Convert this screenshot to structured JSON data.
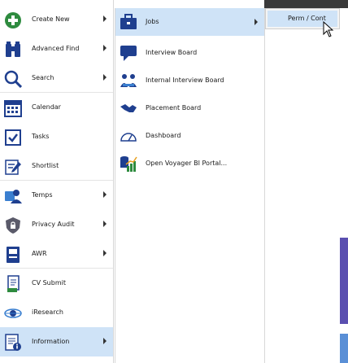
{
  "menu": {
    "items": [
      {
        "label": "Create New",
        "icon": "plus-circle-icon",
        "submenu": true
      },
      {
        "label": "Advanced Find",
        "icon": "binoculars-icon",
        "submenu": true
      },
      {
        "label": "Search",
        "icon": "magnifier-icon",
        "submenu": true
      },
      {
        "label": "Calendar",
        "icon": "calendar-icon",
        "submenu": false
      },
      {
        "label": "Tasks",
        "icon": "tasks-checkbox-icon",
        "submenu": false
      },
      {
        "label": "Shortlist",
        "icon": "shortlist-edit-icon",
        "submenu": false
      },
      {
        "label": "Temps",
        "icon": "temps-people-icon",
        "submenu": true
      },
      {
        "label": "Privacy Audit",
        "icon": "shield-lock-icon",
        "submenu": true
      },
      {
        "label": "AWR",
        "icon": "awr-document-icon",
        "submenu": true
      },
      {
        "label": "CV Submit",
        "icon": "cv-submit-icon",
        "submenu": false
      },
      {
        "label": "iResearch",
        "icon": "iresearch-globe-icon",
        "submenu": false
      },
      {
        "label": "Information",
        "icon": "information-document-icon",
        "submenu": true,
        "selected": true
      }
    ]
  },
  "submenu": {
    "items": [
      {
        "label": "Jobs",
        "icon": "briefcase-icon",
        "submenu": true,
        "selected": true
      },
      {
        "label": "Interview Board",
        "icon": "speech-bubble-icon",
        "submenu": false
      },
      {
        "label": "Internal Interview Board",
        "icon": "interview-people-icon",
        "submenu": false
      },
      {
        "label": "Placement Board",
        "icon": "handshake-icon",
        "submenu": false
      },
      {
        "label": "Dashboard",
        "icon": "speedometer-icon",
        "submenu": false
      },
      {
        "label": "Open Voyager BI Portal...",
        "icon": "bi-chart-icon",
        "submenu": false
      }
    ]
  },
  "submenu2": {
    "items": [
      {
        "label": "Perm / Cont",
        "selected": true
      }
    ]
  },
  "colors": {
    "selection": "#cfe3f7",
    "green": "#2e8b3f",
    "navy": "#1f3f8f",
    "blue": "#2f7fd0"
  }
}
